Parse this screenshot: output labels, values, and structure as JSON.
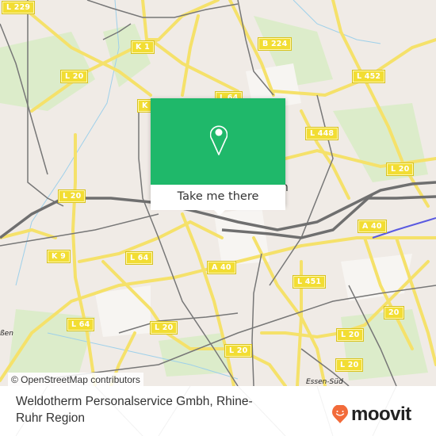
{
  "map": {
    "road_labels": [
      {
        "text": "L 229"
      },
      {
        "text": "K 1"
      },
      {
        "text": "B 224"
      },
      {
        "text": "L 20"
      },
      {
        "text": "L 452"
      },
      {
        "text": "K"
      },
      {
        "text": "L 64"
      },
      {
        "text": "L 448"
      },
      {
        "text": "L 20"
      },
      {
        "text": "L 20"
      },
      {
        "text": "K 9"
      },
      {
        "text": "L 64"
      },
      {
        "text": "A 40"
      },
      {
        "text": "A 40"
      },
      {
        "text": "L 451"
      },
      {
        "text": "20"
      },
      {
        "text": "L 64"
      },
      {
        "text": "L 20"
      },
      {
        "text": "L 20"
      },
      {
        "text": "L 20"
      },
      {
        "text": "L 20"
      }
    ],
    "place_labels": {
      "essen": "Essen",
      "essen_sued": "Essen-Süd",
      "fragment_left": "ßen"
    }
  },
  "popup": {
    "icon": "location-pin-icon",
    "button_label": "Take me there",
    "color": "#1fb86a"
  },
  "attribution": "© OpenStreetMap contributors",
  "place": {
    "title": "Weldotherm Personalservice Gmbh, Rhine-Ruhr Region"
  },
  "brand": {
    "name": "moovit",
    "color": "#f26b3a"
  }
}
